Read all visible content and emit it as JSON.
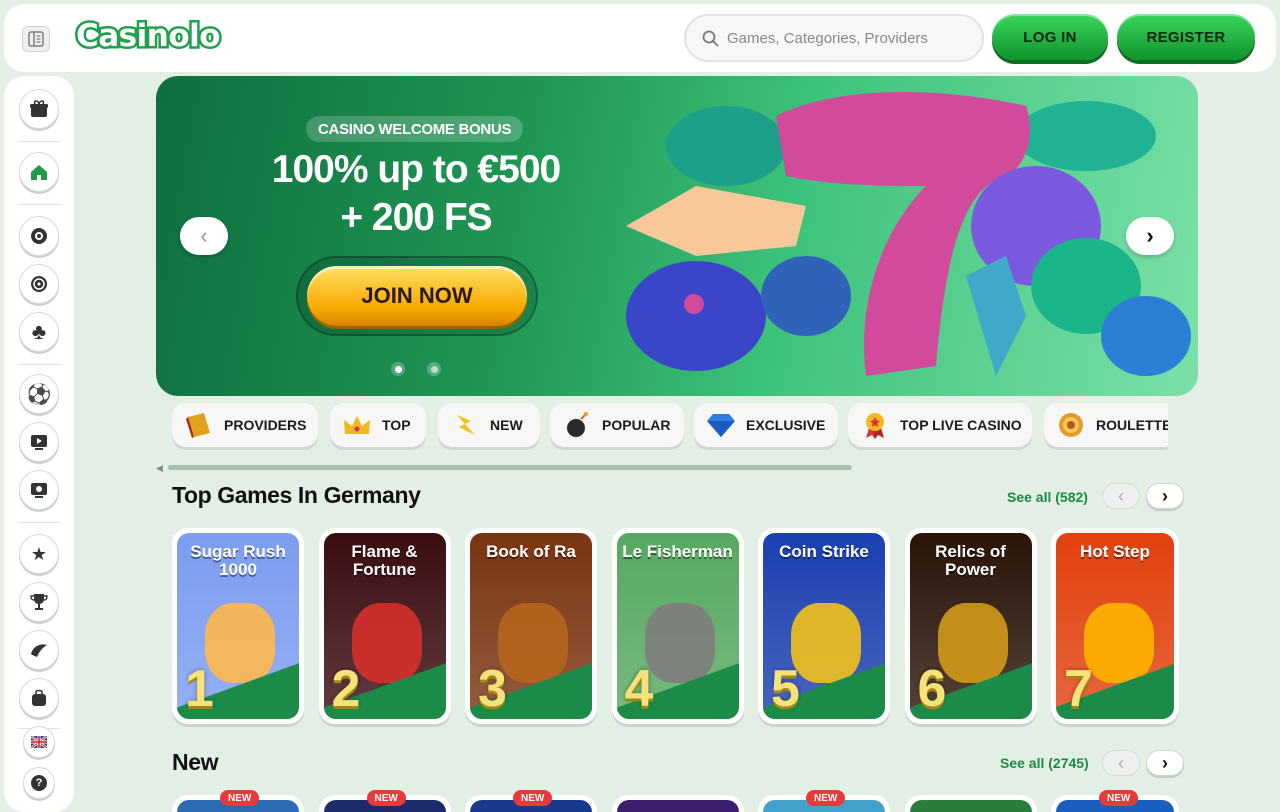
{
  "header": {
    "logo": "Casinolo",
    "search_placeholder": "Games, Categories, Providers",
    "login": "LOG IN",
    "register": "REGISTER"
  },
  "sidebar": {
    "items": [
      {
        "name": "gift-icon",
        "glyph": "🎁"
      },
      {
        "name": "home-icon",
        "glyph": "⌂"
      },
      {
        "name": "casino-chip-icon",
        "glyph": "✪"
      },
      {
        "name": "live-casino-icon",
        "glyph": "◉"
      },
      {
        "name": "clubs-icon",
        "glyph": "♣"
      },
      {
        "name": "football-icon",
        "glyph": "⚽"
      },
      {
        "name": "tv-icon",
        "glyph": "▶"
      },
      {
        "name": "virtual-sports-icon",
        "glyph": "⊞"
      },
      {
        "name": "vip-star-icon",
        "glyph": "★"
      },
      {
        "name": "trophy-icon",
        "glyph": "🏆"
      },
      {
        "name": "promotions-icon",
        "glyph": "◐"
      },
      {
        "name": "shop-bag-icon",
        "glyph": "👜"
      },
      {
        "name": "uk-flag-icon",
        "glyph": "🇬🇧"
      },
      {
        "name": "help-icon",
        "glyph": "?"
      }
    ]
  },
  "hero": {
    "tag": "CASINO WELCOME BONUS",
    "title_line1": "100% up to €500",
    "title_line2": "+ 200 FS",
    "cta": "JOIN NOW",
    "prev": "‹",
    "next": "›"
  },
  "categories": [
    {
      "label": "PROVIDERS",
      "icon": "book-icon"
    },
    {
      "label": "TOP",
      "icon": "crown-icon"
    },
    {
      "label": "NEW",
      "icon": "lightning-icon"
    },
    {
      "label": "POPULAR",
      "icon": "bomb-icon"
    },
    {
      "label": "EXCLUSIVE",
      "icon": "diamond-icon"
    },
    {
      "label": "TOP LIVE CASINO",
      "icon": "medal-icon"
    },
    {
      "label": "ROULETTE",
      "icon": "roulette-icon"
    }
  ],
  "top_games": {
    "title": "Top Games In Germany",
    "see_all": "See all (582)",
    "games": [
      {
        "name": "Sugar Rush 1000",
        "rank": "1",
        "bg": "#7b9cf0",
        "art": "#ffb84d"
      },
      {
        "name": "Flame & Fortune",
        "rank": "2",
        "bg": "#3a0c10",
        "art": "#d5302c"
      },
      {
        "name": "Book of Ra",
        "rank": "3",
        "bg": "#7a3410",
        "art": "#b5651d"
      },
      {
        "name": "Le Fisherman",
        "rank": "4",
        "bg": "#56a860",
        "art": "#7d7d7d"
      },
      {
        "name": "Coin Strike",
        "rank": "5",
        "bg": "#1a3fb0",
        "art": "#f2c11a"
      },
      {
        "name": "Relics of Power",
        "rank": "6",
        "bg": "#2a1408",
        "art": "#d29a1a"
      },
      {
        "name": "Hot Step",
        "rank": "7",
        "bg": "#e1410d",
        "art": "#ffb200"
      }
    ]
  },
  "new_games": {
    "title": "New",
    "see_all": "See all (2745)",
    "badge": "NEW",
    "cards": [
      "#2a6bb4",
      "#1b2b6b",
      "#173a8c",
      "#3c1e6e",
      "#43a1c9",
      "#2b7d3b",
      "#1a5fc0"
    ]
  }
}
